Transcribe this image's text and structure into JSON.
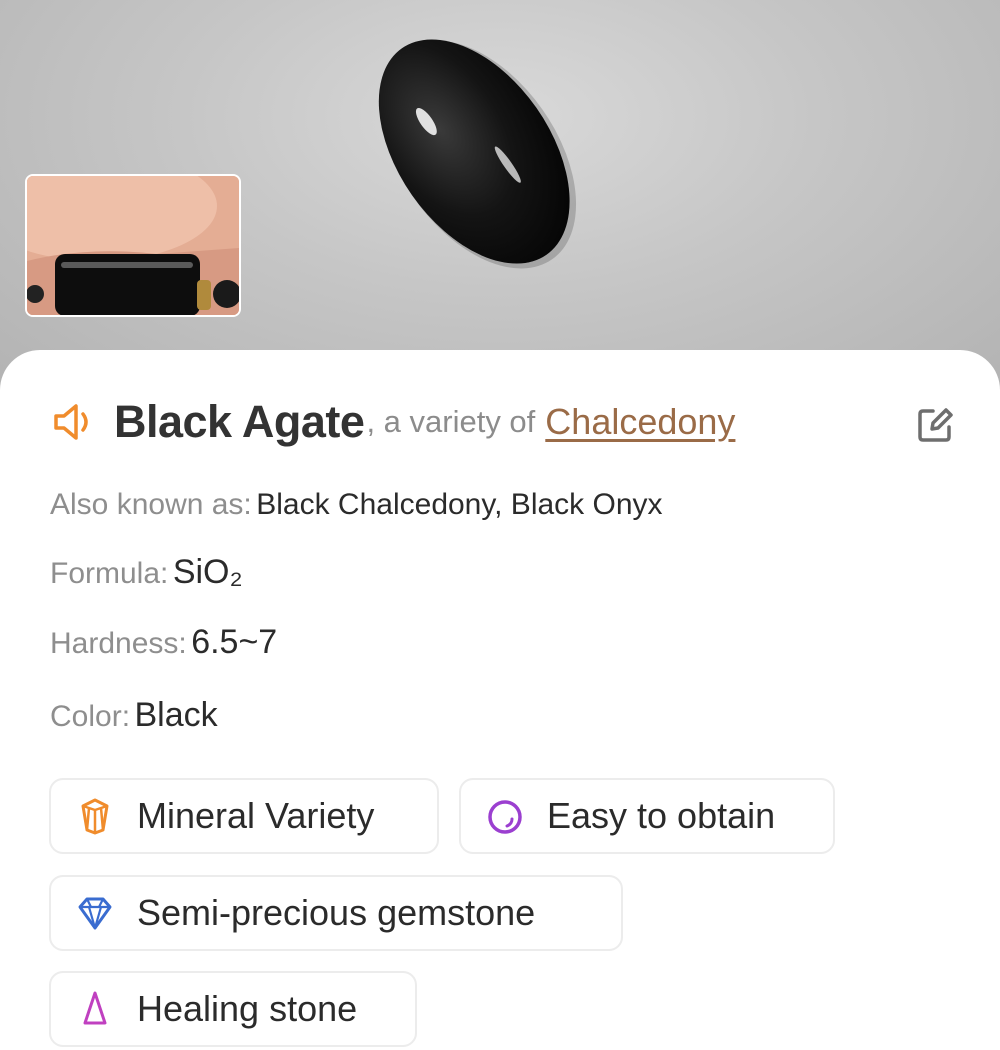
{
  "header": {
    "name": "Black Agate",
    "connector": ", a variety of",
    "parent_link": "Chalcedony",
    "speaker_icon": "speaker-icon",
    "edit_icon": "edit-icon"
  },
  "info": {
    "aka_label": "Also known as:",
    "aka_value": "Black Chalcedony, Black Onyx",
    "formula_label": "Formula:",
    "formula_value": "SiO₂",
    "hardness_label": "Hardness:",
    "hardness_value": "6.5~7",
    "color_label": "Color:",
    "color_value": "Black"
  },
  "tags": [
    {
      "label": "Mineral Variety",
      "icon": "crystal-icon",
      "color": "#f08c2c"
    },
    {
      "label": "Easy to obtain",
      "icon": "ring-icon",
      "color": "#9b3fd0"
    },
    {
      "label": "Semi-precious gemstone",
      "icon": "diamond-icon",
      "color": "#3a6cd0"
    },
    {
      "label": "Healing stone",
      "icon": "healing-icon",
      "color": "#c040c0"
    }
  ],
  "colors": {
    "accent_orange": "#f08c2c",
    "link_brown": "#9a6b47"
  }
}
